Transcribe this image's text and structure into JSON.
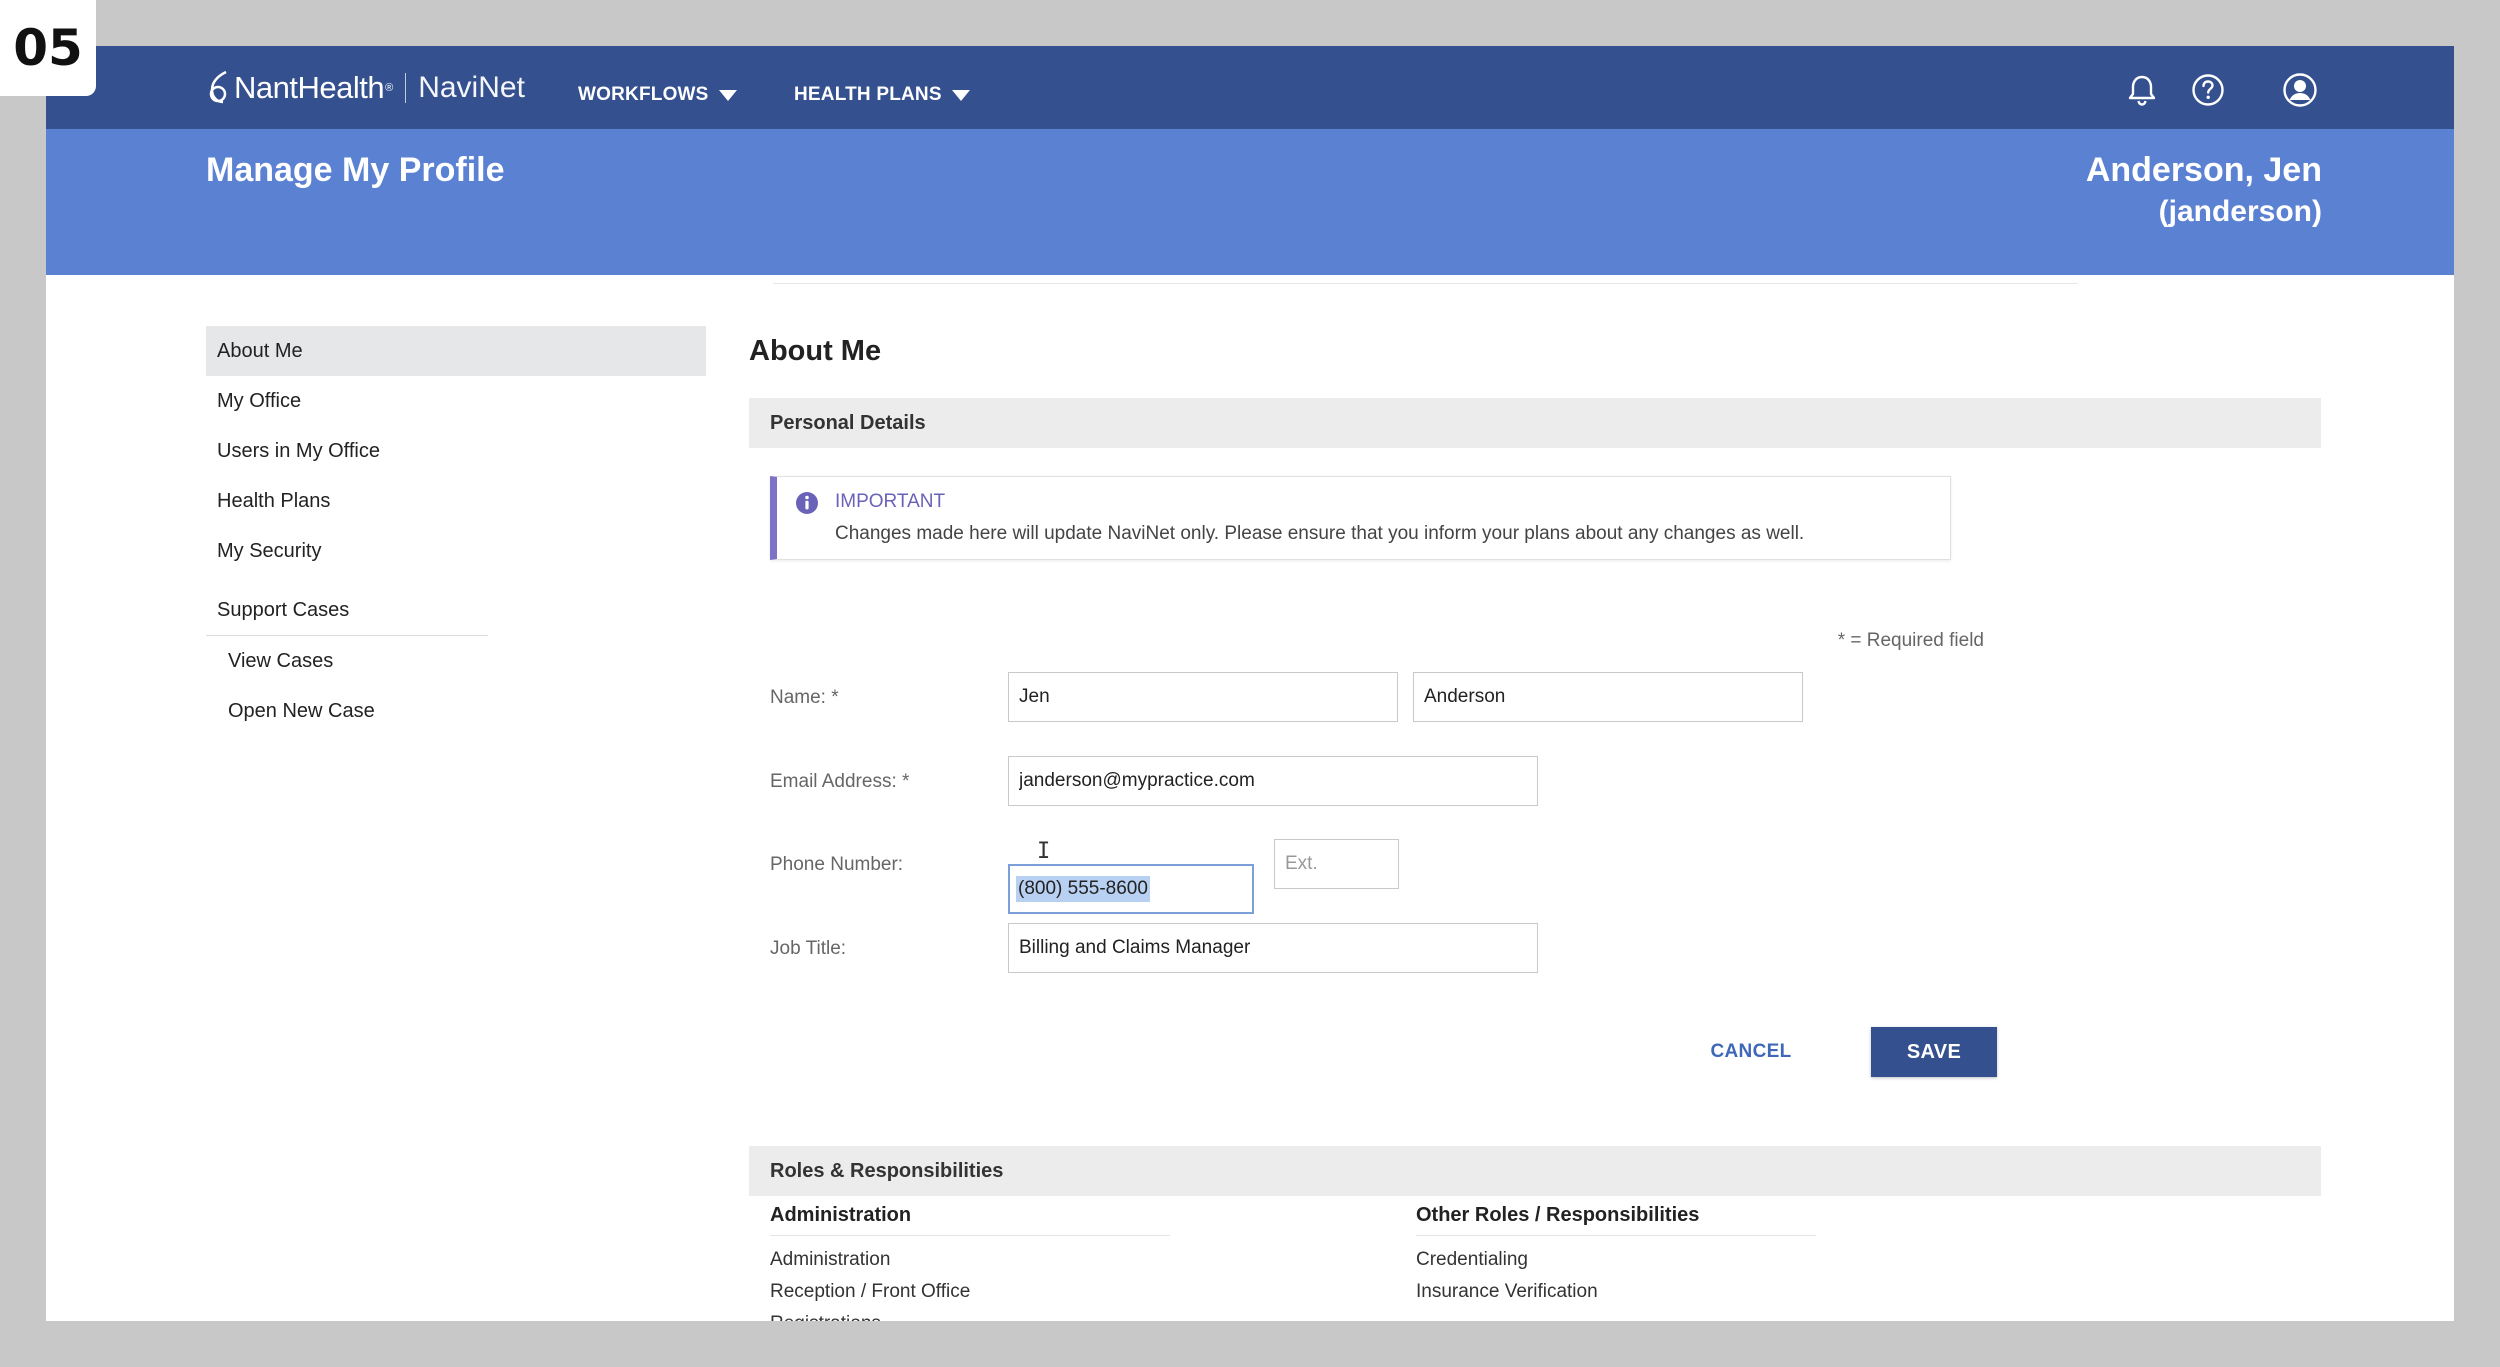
{
  "step_badge": "05",
  "brand": {
    "name": "NantHealth",
    "registered": "®",
    "product": "NaviNet"
  },
  "nav": {
    "workflows": "WORKFLOWS",
    "health_plans": "HEALTH PLANS"
  },
  "header": {
    "page_title": "Manage My Profile",
    "user_name": "Anderson, Jen",
    "user_login": "(janderson)"
  },
  "sidebar": {
    "items": [
      {
        "label": "About Me",
        "active": true
      },
      {
        "label": "My Office"
      },
      {
        "label": "Users in My Office"
      },
      {
        "label": "Health Plans"
      },
      {
        "label": "My Security"
      }
    ],
    "support_cases": "Support Cases",
    "sub_items": [
      {
        "label": "View Cases"
      },
      {
        "label": "Open New Case"
      }
    ]
  },
  "main": {
    "title": "About Me",
    "personal_details": "Personal Details",
    "notice": {
      "title": "IMPORTANT",
      "text": "Changes made here will update NaviNet only.  Please ensure that you inform your plans about any changes as well."
    },
    "required_note": "* = Required field",
    "form": {
      "name_label": "Name: *",
      "first_name": "Jen",
      "last_name": "Anderson",
      "email_label": "Email Address: *",
      "email": "janderson@mypractice.com",
      "phone_label": "Phone Number:",
      "phone": "(800) 555-8600",
      "ext_placeholder": "Ext.",
      "job_label": "Job Title:",
      "job_title": "Billing and Claims Manager"
    },
    "cancel": "CANCEL",
    "save": "SAVE",
    "roles_title": "Roles & Responsibilities",
    "roles_left": {
      "heading": "Administration",
      "items": [
        "Administration",
        "Reception / Front Office",
        "Registrations"
      ]
    },
    "roles_right": {
      "heading": "Other Roles / Responsibilities",
      "items": [
        "Credentialing",
        "Insurance Verification"
      ]
    }
  },
  "colors": {
    "topbar": "#34508f",
    "profile_band": "#5b81d2",
    "notice_accent": "#7c73c8",
    "link": "#3f69b8"
  },
  "icons": [
    "bell-icon",
    "help-icon",
    "user-account-icon",
    "info-icon",
    "caret-down-icon"
  ]
}
